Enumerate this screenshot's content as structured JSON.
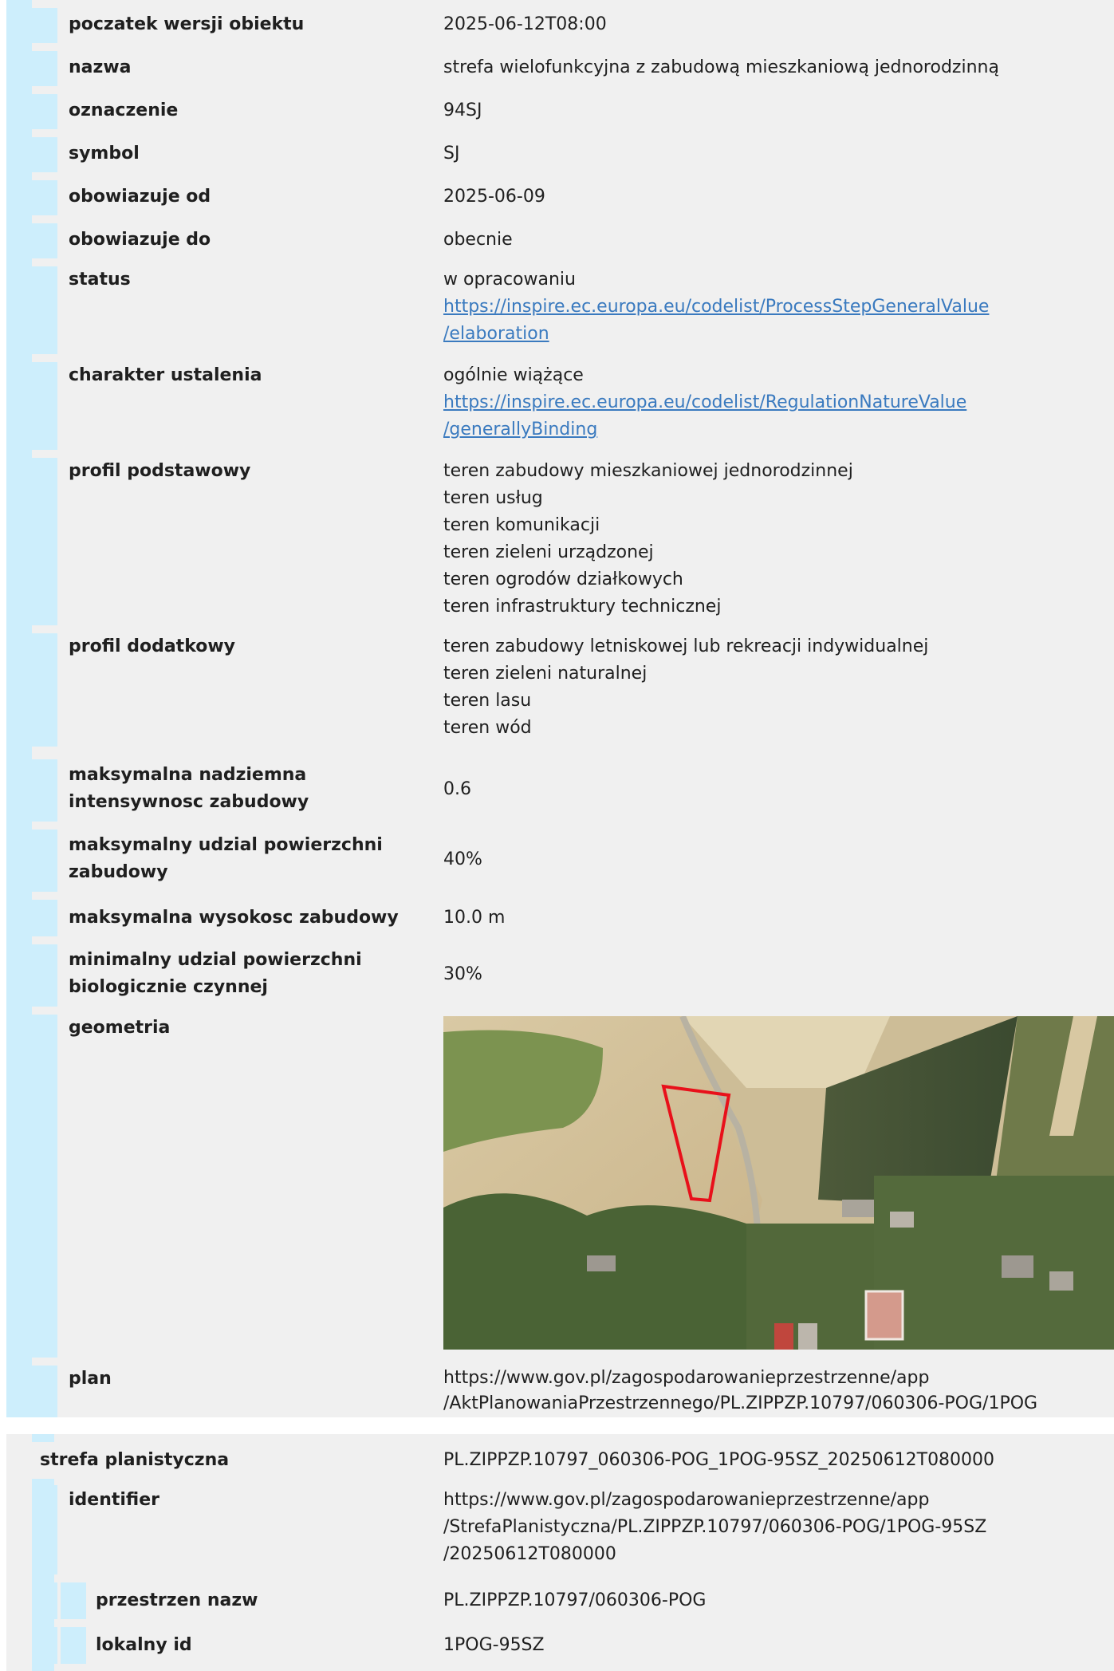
{
  "rows": {
    "poczatek": {
      "label": "poczatek wersji obiektu",
      "value": "2025-06-12T08:00"
    },
    "nazwa": {
      "label": "nazwa",
      "value": "strefa wielofunkcyjna z zabudową mieszkaniową jednorodzinną"
    },
    "oznaczenie": {
      "label": "oznaczenie",
      "value": "94SJ"
    },
    "symbol": {
      "label": "symbol",
      "value": "SJ"
    },
    "obow_od": {
      "label": "obowiazuje od",
      "value": "2025-06-09"
    },
    "obow_do": {
      "label": "obowiazuje do",
      "value": "obecnie"
    },
    "status": {
      "label": "status",
      "value": "w opracowaniu",
      "link1": "https://inspire.ec.europa.eu/codelist/ProcessStepGeneralValue",
      "link2": "/elaboration"
    },
    "charakter": {
      "label": "charakter ustalenia",
      "value": "ogólnie wiążące",
      "link1": "https://inspire.ec.europa.eu/codelist/RegulationNatureValue",
      "link2": "/generallyBinding"
    },
    "profil_podst": {
      "label": "profil podstawowy",
      "items": [
        "teren zabudowy mieszkaniowej jednorodzinnej",
        "teren usług",
        "teren komunikacji",
        "teren zieleni urządzonej",
        "teren ogrodów działkowych",
        "teren infrastruktury technicznej"
      ]
    },
    "profil_dod": {
      "label": "profil dodatkowy",
      "items": [
        "teren zabudowy letniskowej lub rekreacji indywidualnej",
        "teren zieleni naturalnej",
        "teren lasu",
        "teren wód"
      ]
    },
    "intensywnosc": {
      "label1": "maksymalna nadziemna",
      "label2": "intensywnosc zabudowy",
      "value": "0.6"
    },
    "udzial": {
      "label1": "maksymalny udzial powierzchni",
      "label2": "zabudowy",
      "value": "40%"
    },
    "wysokosc": {
      "label": "maksymalna wysokosc zabudowy",
      "value": "10.0 m"
    },
    "biol": {
      "label1": "minimalny udzial powierzchni",
      "label2": "biologicznie czynnej",
      "value": "30%"
    },
    "geometria": {
      "label": "geometria"
    },
    "plan": {
      "label": "plan",
      "line1": "https://www.gov.pl/zagospodarowanieprzestrzenne/app",
      "line2": "/AktPlanowaniaPrzestrzennego/PL.ZIPPZP.10797/060306-POG/1POG"
    }
  },
  "strefa": {
    "label": "strefa planistyczna",
    "value": "PL.ZIPPZP.10797_060306-POG_1POG-95SZ_20250612T080000",
    "identifier": {
      "label": "identifier",
      "line1": "https://www.gov.pl/zagospodarowanieprzestrzenne/app",
      "line2": "/StrefaPlanistyczna/PL.ZIPPZP.10797/060306-POG/1POG-95SZ",
      "line3": "/20250612T080000"
    },
    "przestrzen": {
      "label": "przestrzen nazw",
      "value": "PL.ZIPPZP.10797/060306-POG"
    },
    "lokalny": {
      "label": "lokalny id",
      "value": "1POG-95SZ"
    }
  },
  "colors": {
    "gutter": "#cdeefc",
    "row_bg": "#f0f0f0",
    "link": "#3a7abf",
    "polygon": "#e8101a"
  }
}
